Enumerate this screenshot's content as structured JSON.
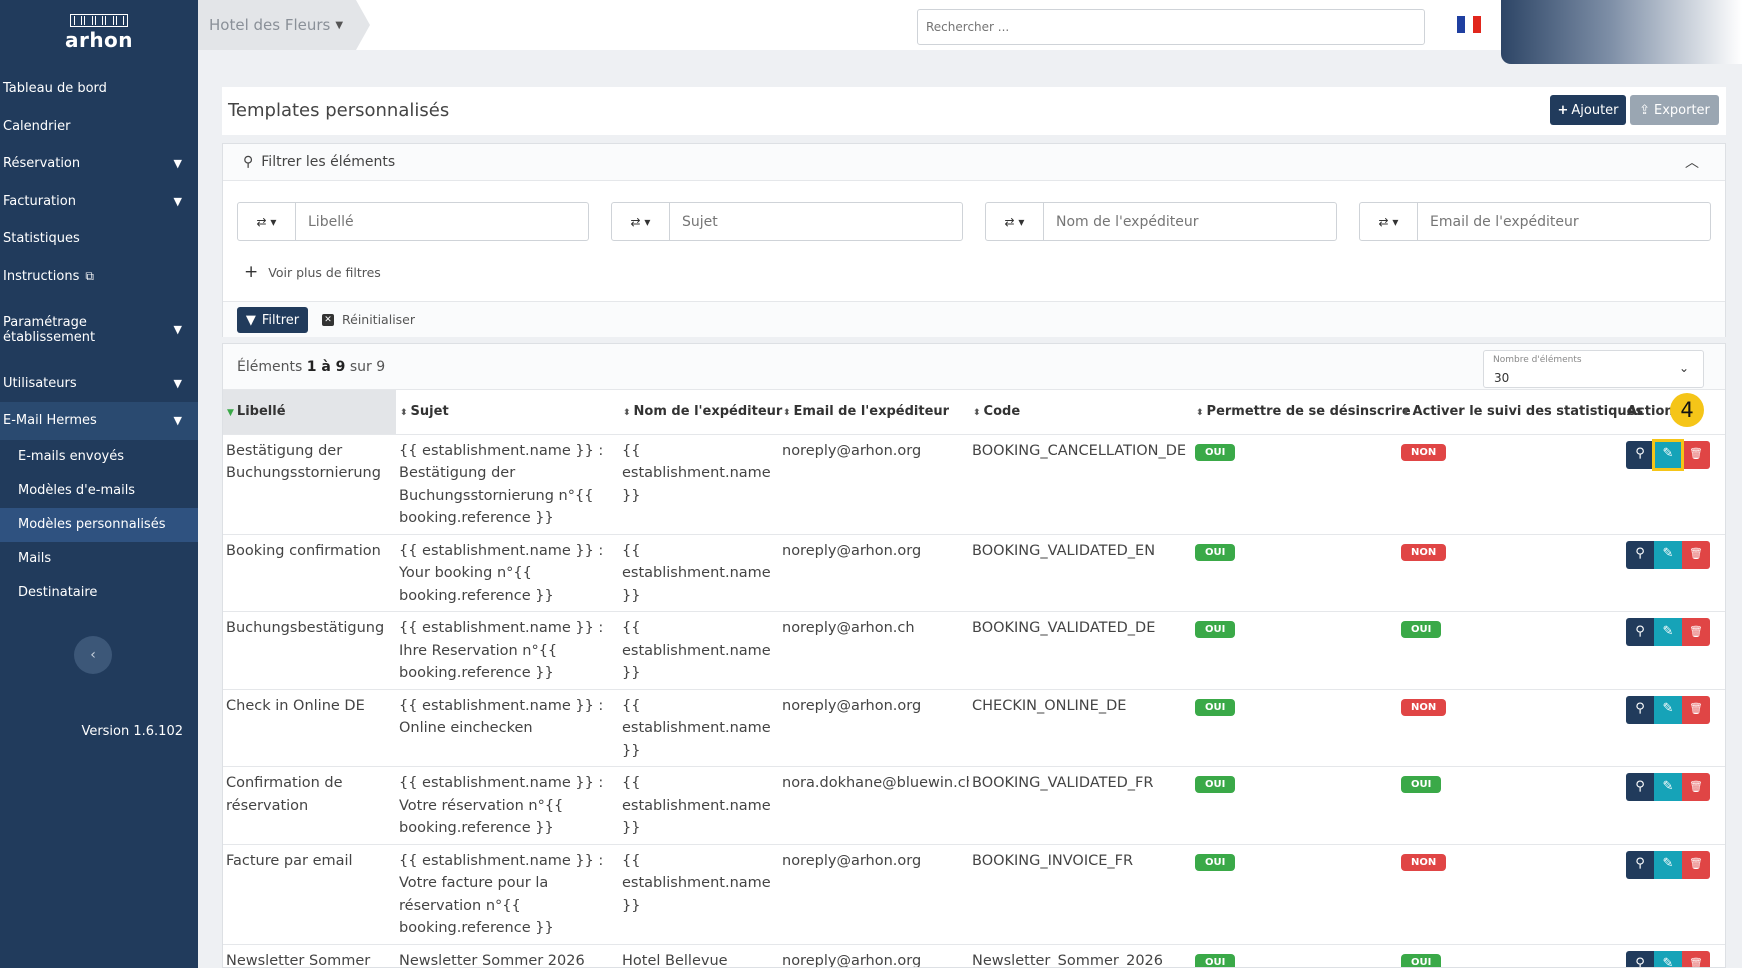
{
  "brand": {
    "logo_text": "arhon"
  },
  "sidebar": {
    "items": [
      {
        "label": "Tableau de bord",
        "chev": ""
      },
      {
        "label": "Calendrier",
        "chev": ""
      },
      {
        "label": "Réservation",
        "chev": "⌄"
      },
      {
        "label": "Facturation",
        "chev": "⌄"
      },
      {
        "label": "Statistiques",
        "chev": ""
      },
      {
        "label": "Instructions",
        "chev": ""
      }
    ],
    "settings": "Paramétrage établissement",
    "users": "Utilisateurs",
    "hermes": "E-Mail Hermes",
    "sub_items": [
      "E-mails envoyés",
      "Modèles d'e-mails",
      "Modèles personnalisés",
      "Mails",
      "Destinataire"
    ],
    "version": "Version 1.6.102"
  },
  "topbar": {
    "establishment": "Hotel des Fleurs",
    "search_placeholder": "Rechercher ...",
    "flag_colors": [
      "#1f3fa0",
      "#ffffff",
      "#e1261c"
    ]
  },
  "page": {
    "title": "Templates personnalisés",
    "add_label": "Ajouter",
    "export_label": "Exporter"
  },
  "filters": {
    "header": "Filtrer les éléments",
    "fields": [
      "Libellé",
      "Sujet",
      "Nom de l'expéditeur",
      "Email de l'expéditeur"
    ],
    "more_label": "Voir plus de filtres",
    "filter_button": "Filtrer",
    "reset_button": "Réinitialiser"
  },
  "table": {
    "count_prefix": "Éléments ",
    "count_range": "1 à 9",
    "count_suffix": " sur 9",
    "page_size_label": "Nombre d'éléments",
    "page_size": "30",
    "columns": [
      "Libellé",
      "Sujet",
      "Nom de l'expéditeur",
      "Email de l'expéditeur",
      "Code",
      "Permettre de se désinscrire",
      "Activer le suivi des statistiques",
      "Actions"
    ],
    "rows": [
      {
        "libelle": "Bestätigung der Buchungsstornierung",
        "sujet": "{{ establishment.name }} : Bestätigung der Buchungsstornierung n°{{ booking.reference }}",
        "nom": "{{ establishment.name }}",
        "email": "noreply@arhon.org",
        "code": "BOOKING_CANCELLATION_DE",
        "unsub": "OUI",
        "stats": "NON"
      },
      {
        "libelle": "Booking confirmation",
        "sujet": "{{ establishment.name }} : Your booking n°{{ booking.reference }}",
        "nom": "{{ establishment.name }}",
        "email": "noreply@arhon.org",
        "code": "BOOKING_VALIDATED_EN",
        "unsub": "OUI",
        "stats": "NON"
      },
      {
        "libelle": "Buchungsbestätigung",
        "sujet": "{{ establishment.name }} : Ihre Reservation n°{{ booking.reference }}",
        "nom": "{{ establishment.name }}",
        "email": "noreply@arhon.ch",
        "code": "BOOKING_VALIDATED_DE",
        "unsub": "OUI",
        "stats": "OUI"
      },
      {
        "libelle": "Check in Online DE",
        "sujet": "{{ establishment.name }} : Online einchecken",
        "nom": "{{ establishment.name }}",
        "email": "noreply@arhon.org",
        "code": "CHECKIN_ONLINE_DE",
        "unsub": "OUI",
        "stats": "NON"
      },
      {
        "libelle": "Confirmation de réservation",
        "sujet": "{{ establishment.name }} : Votre réservation n°{{ booking.reference }}",
        "nom": "{{ establishment.name }}",
        "email": "nora.dokhane@bluewin.ch",
        "code": "BOOKING_VALIDATED_FR",
        "unsub": "OUI",
        "stats": "OUI"
      },
      {
        "libelle": "Facture par email",
        "sujet": "{{ establishment.name }} : Votre facture pour la réservation n°{{ booking.reference }}",
        "nom": "{{ establishment.name }}",
        "email": "noreply@arhon.org",
        "code": "BOOKING_INVOICE_FR",
        "unsub": "OUI",
        "stats": "NON"
      },
      {
        "libelle": "Newsletter Sommer",
        "sujet": "Newsletter Sommer 2026",
        "nom": "Hotel Bellevue",
        "email": "noreply@arhon.org",
        "code": "Newsletter_Sommer_2026",
        "unsub": "OUI",
        "stats": "OUI"
      }
    ]
  },
  "annotation": {
    "step": "4",
    "color": "#f5c518"
  }
}
